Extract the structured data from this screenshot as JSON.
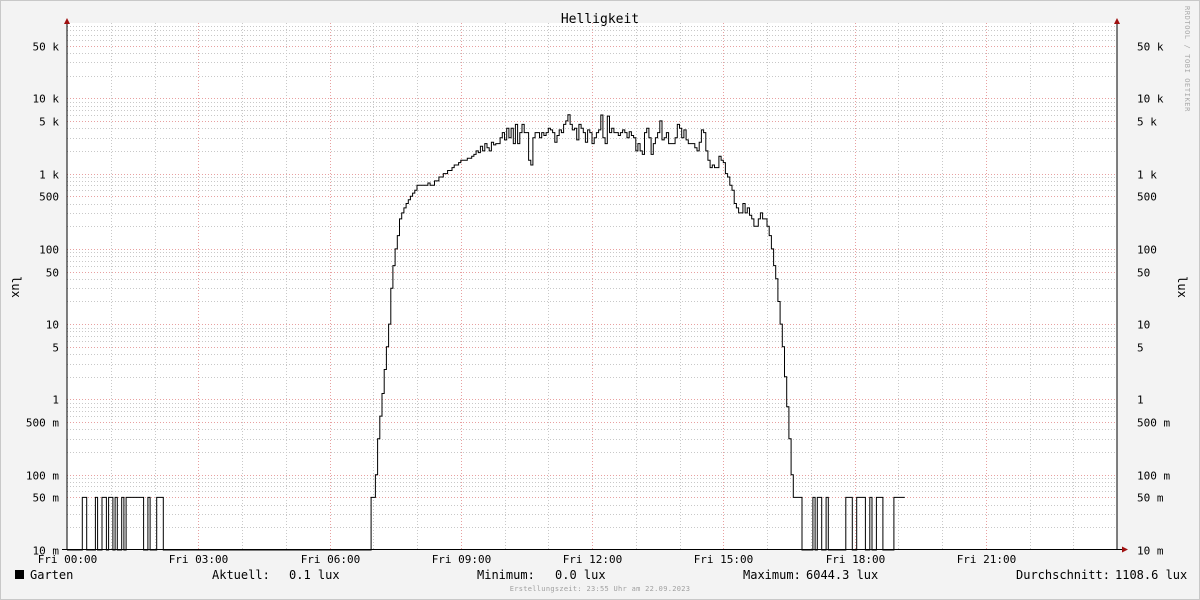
{
  "chart_data": {
    "type": "line",
    "title": "Helligkeit",
    "ylabel": "lux",
    "yscale": "log",
    "ylim": [
      0.01,
      100000
    ],
    "y_ticks": [
      {
        "value": 0.01,
        "label": "10 m"
      },
      {
        "value": 0.05,
        "label": "50 m"
      },
      {
        "value": 0.1,
        "label": "100 m"
      },
      {
        "value": 0.5,
        "label": "500 m"
      },
      {
        "value": 1,
        "label": "1"
      },
      {
        "value": 5,
        "label": "5"
      },
      {
        "value": 10,
        "label": "10"
      },
      {
        "value": 50,
        "label": "50"
      },
      {
        "value": 100,
        "label": "100"
      },
      {
        "value": 500,
        "label": "500"
      },
      {
        "value": 1000,
        "label": "1 k"
      },
      {
        "value": 5000,
        "label": "5 k"
      },
      {
        "value": 10000,
        "label": "10 k"
      },
      {
        "value": 50000,
        "label": "50 k"
      }
    ],
    "xlim_hours": [
      0,
      24
    ],
    "x_ticks": [
      {
        "hour": 0,
        "label": "Fri 00:00"
      },
      {
        "hour": 3,
        "label": "Fri 03:00"
      },
      {
        "hour": 6,
        "label": "Fri 06:00"
      },
      {
        "hour": 9,
        "label": "Fri 09:00"
      },
      {
        "hour": 12,
        "label": "Fri 12:00"
      },
      {
        "hour": 15,
        "label": "Fri 15:00"
      },
      {
        "hour": 18,
        "label": "Fri 18:00"
      },
      {
        "hour": 21,
        "label": "Fri 21:00"
      }
    ],
    "grid": true,
    "colors": {
      "line": "#000000",
      "major_grid": "#e8a0a0",
      "minor_grid": "#c8c8c8",
      "axis_arrow": "#a01010"
    },
    "series": [
      {
        "name": "Garten",
        "x_hours": [
          0,
          0.05,
          0.1,
          0.15,
          0.2,
          0.25,
          0.3,
          0.35,
          0.4,
          0.45,
          0.5,
          0.55,
          0.6,
          0.65,
          0.7,
          0.75,
          0.8,
          0.85,
          0.9,
          0.95,
          1,
          1.05,
          1.1,
          1.15,
          1.2,
          1.25,
          1.3,
          1.35,
          1.4,
          1.45,
          1.5,
          1.55,
          1.6,
          1.65,
          1.7,
          1.75,
          1.8,
          1.85,
          1.9,
          1.95,
          2,
          2.05,
          2.1,
          2.15,
          2.2,
          2.25,
          2.3,
          2.35,
          2.4,
          2.45,
          2.5,
          2.55,
          2.6,
          2.65,
          2.7,
          2.75,
          2.8,
          2.85,
          2.9,
          2.95,
          3,
          3.05,
          3.1,
          3.15,
          3.2,
          3.25,
          3.3,
          3.35,
          3.4,
          3.45,
          3.5,
          3.55,
          3.6,
          3.65,
          3.7,
          3.75,
          3.8,
          3.85,
          3.9,
          3.95,
          4,
          4.05,
          4.1,
          4.15,
          4.2,
          4.25,
          4.3,
          4.35,
          4.4,
          4.45,
          4.5,
          4.55,
          4.6,
          4.65,
          4.7,
          4.75,
          4.8,
          4.85,
          4.9,
          4.95,
          5,
          5.05,
          5.1,
          5.15,
          5.2,
          5.25,
          5.3,
          5.35,
          5.4,
          5.45,
          5.5,
          5.55,
          5.6,
          5.65,
          5.7,
          5.75,
          5.8,
          5.85,
          5.9,
          5.95,
          6,
          6.05,
          6.1,
          6.15,
          6.2,
          6.25,
          6.3,
          6.35,
          6.4,
          6.45,
          6.5,
          6.55,
          6.6,
          6.65,
          6.7,
          6.75,
          6.8,
          6.85,
          6.9,
          6.95,
          7,
          7.05,
          7.1,
          7.15,
          7.2,
          7.25,
          7.3,
          7.35,
          7.4,
          7.45,
          7.5,
          7.55,
          7.6,
          7.65,
          7.7,
          7.75,
          7.8,
          7.85,
          7.9,
          7.95,
          8,
          8.05,
          8.1,
          8.15,
          8.2,
          8.25,
          8.3,
          8.35,
          8.4,
          8.45,
          8.5,
          8.55,
          8.6,
          8.65,
          8.7,
          8.75,
          8.8,
          8.85,
          8.9,
          8.95,
          9,
          9.05,
          9.1,
          9.15,
          9.2,
          9.25,
          9.3,
          9.35,
          9.4,
          9.45,
          9.5,
          9.55,
          9.6,
          9.65,
          9.7,
          9.75,
          9.8,
          9.85,
          9.9,
          9.95,
          10,
          10.05,
          10.1,
          10.15,
          10.2,
          10.25,
          10.3,
          10.35,
          10.4,
          10.45,
          10.5,
          10.55,
          10.6,
          10.65,
          10.7,
          10.75,
          10.8,
          10.85,
          10.9,
          10.95,
          11,
          11.05,
          11.1,
          11.15,
          11.2,
          11.25,
          11.3,
          11.35,
          11.4,
          11.45,
          11.5,
          11.55,
          11.6,
          11.65,
          11.7,
          11.75,
          11.8,
          11.85,
          11.9,
          11.95,
          12,
          12.05,
          12.1,
          12.15,
          12.2,
          12.25,
          12.3,
          12.35,
          12.4,
          12.45,
          12.5,
          12.55,
          12.6,
          12.65,
          12.7,
          12.75,
          12.8,
          12.85,
          12.9,
          12.95,
          13,
          13.05,
          13.1,
          13.15,
          13.2,
          13.25,
          13.3,
          13.35,
          13.4,
          13.45,
          13.5,
          13.55,
          13.6,
          13.65,
          13.7,
          13.75,
          13.8,
          13.85,
          13.9,
          13.95,
          14,
          14.05,
          14.1,
          14.15,
          14.2,
          14.25,
          14.3,
          14.35,
          14.4,
          14.45,
          14.5,
          14.55,
          14.6,
          14.65,
          14.7,
          14.75,
          14.8,
          14.85,
          14.9,
          14.95,
          15,
          15.05,
          15.1,
          15.15,
          15.2,
          15.25,
          15.3,
          15.35,
          15.4,
          15.45,
          15.5,
          15.55,
          15.6,
          15.65,
          15.7,
          15.75,
          15.8,
          15.85,
          15.9,
          15.95,
          16,
          16.05,
          16.1,
          16.15,
          16.2,
          16.25,
          16.3,
          16.35,
          16.4,
          16.45,
          16.5,
          16.55,
          16.6,
          16.65,
          16.7,
          16.75,
          16.8,
          16.85,
          16.9,
          16.95,
          17,
          17.05,
          17.1,
          17.15,
          17.2,
          17.25,
          17.3,
          17.35,
          17.4,
          17.45,
          17.5,
          17.55,
          17.6,
          17.65,
          17.7,
          17.75,
          17.8,
          17.85,
          17.9,
          17.95,
          18,
          18.05,
          18.1,
          18.15,
          18.2,
          18.25,
          18.3,
          18.35,
          18.4,
          18.45,
          18.5,
          18.55,
          18.6,
          18.65,
          18.7,
          18.75,
          18.8,
          18.85,
          18.9,
          18.95,
          19,
          19.05,
          19.1,
          19.15,
          19.2,
          19.25,
          19.3,
          19.35,
          19.4,
          19.45,
          19.5,
          19.55,
          19.6,
          19.65,
          19.7,
          19.75,
          19.8,
          19.85,
          19.9,
          19.95,
          20,
          20.05,
          20.1,
          20.15,
          20.2,
          20.25,
          20.3,
          20.35,
          20.4,
          20.45,
          20.5,
          20.55,
          20.6,
          20.65,
          20.7,
          20.75,
          20.8,
          20.85,
          20.9,
          20.95,
          21,
          21.05,
          21.1,
          21.15,
          21.2,
          21.25,
          21.3,
          21.35,
          21.4,
          21.45,
          21.5,
          21.55,
          21.6,
          21.65,
          21.7,
          21.75,
          21.8,
          21.85,
          21.9,
          21.95,
          22,
          22.05,
          22.1,
          22.15,
          22.2,
          22.25,
          22.3,
          22.35,
          22.4,
          22.45,
          22.5,
          22.55,
          22.6,
          22.65,
          22.7,
          22.75,
          22.8,
          22.85,
          22.9,
          22.95,
          23,
          23.05,
          23.1,
          23.15,
          23.2,
          23.25,
          23.3,
          23.35,
          23.4,
          23.45,
          23.5,
          23.55,
          23.6,
          23.65,
          23.7,
          23.75,
          23.8,
          23.85,
          23.9,
          23.95
        ],
        "values": [
          0,
          0,
          0,
          0,
          0,
          0,
          0,
          0.05,
          0.05,
          0,
          0,
          0,
          0,
          0.05,
          0,
          0,
          0.05,
          0.05,
          0,
          0.05,
          0.05,
          0,
          0.05,
          0,
          0,
          0.05,
          0,
          0.05,
          0.05,
          0.05,
          0.05,
          0.05,
          0.05,
          0.05,
          0.05,
          0,
          0,
          0.05,
          0,
          0,
          0,
          0.05,
          0.05,
          0.05,
          0,
          0,
          0,
          0,
          0,
          0,
          0,
          0,
          0,
          0,
          0,
          0,
          0,
          0,
          0,
          0,
          0,
          0,
          0,
          0,
          0,
          0,
          0,
          0,
          0,
          0,
          0,
          0,
          0,
          0,
          0,
          0,
          0,
          0,
          0,
          0,
          0,
          0,
          0,
          0,
          0,
          0,
          0,
          0,
          0,
          0,
          0,
          0,
          0,
          0,
          0,
          0,
          0,
          0,
          0,
          0,
          0,
          0,
          0,
          0,
          0,
          0,
          0,
          0,
          0,
          0,
          0,
          0,
          0,
          0,
          0,
          0,
          0,
          0,
          0,
          0,
          0,
          0,
          0,
          0,
          0,
          0,
          0,
          0,
          0,
          0,
          0,
          0,
          0,
          0,
          0,
          0,
          0,
          0,
          0,
          0.05,
          0.05,
          0.1,
          0.3,
          0.6,
          1.2,
          2.5,
          5,
          10,
          30,
          60,
          100,
          150,
          250,
          300,
          350,
          400,
          450,
          500,
          550,
          600,
          700,
          700,
          700,
          700,
          700,
          750,
          700,
          700,
          800,
          800,
          900,
          900,
          1000,
          1000,
          1100,
          1100,
          1200,
          1300,
          1300,
          1400,
          1500,
          1500,
          1500,
          1600,
          1600,
          1700,
          1800,
          2000,
          1900,
          2300,
          2000,
          2500,
          2200,
          2000,
          2600,
          2400,
          2500,
          2500,
          3000,
          3500,
          2800,
          4000,
          3000,
          4000,
          2500,
          4500,
          2500,
          3500,
          4500,
          3500,
          3500,
          1500,
          1300,
          3000,
          3500,
          3500,
          3000,
          3500,
          3200,
          3500,
          4000,
          3800,
          3500,
          2600,
          3200,
          3800,
          3500,
          4500,
          5000,
          6044,
          4500,
          3800,
          4000,
          2800,
          4500,
          4000,
          3500,
          2600,
          3800,
          3500,
          2500,
          3000,
          3500,
          3800,
          6000,
          3000,
          2500,
          5800,
          3500,
          4000,
          3500,
          3500,
          3200,
          3500,
          3800,
          3500,
          3000,
          3600,
          3200,
          3000,
          2000,
          2500,
          2000,
          1800,
          3500,
          4000,
          3000,
          1800,
          2500,
          3000,
          3500,
          5000,
          2800,
          3000,
          3500,
          2500,
          2500,
          2500,
          3000,
          4500,
          4000,
          3000,
          3800,
          2800,
          2500,
          2500,
          2500,
          2200,
          2000,
          2600,
          3800,
          3500,
          2000,
          1500,
          1200,
          1300,
          1200,
          1200,
          1700,
          1500,
          1400,
          1000,
          900,
          700,
          600,
          400,
          350,
          300,
          300,
          400,
          300,
          350,
          280,
          250,
          200,
          200,
          250,
          300,
          250,
          250,
          200,
          150,
          100,
          60,
          40,
          20,
          10,
          5,
          2,
          0.8,
          0.3,
          0.1,
          0.05,
          0.05,
          0.05,
          0.05,
          0,
          0,
          0,
          0,
          0,
          0.05,
          0,
          0.05,
          0.05,
          0,
          0,
          0.05,
          0,
          0,
          0,
          0,
          0,
          0,
          0,
          0,
          0.05,
          0.05,
          0.05,
          0,
          0,
          0.05,
          0.05,
          0.05,
          0.05,
          0,
          0,
          0.05,
          0,
          0,
          0.05,
          0.05,
          0.05,
          0,
          0,
          0,
          0,
          0,
          0.05,
          0.05,
          0.05,
          0.05,
          0.05
        ]
      }
    ],
    "legend": {
      "series_name": "Garten",
      "current_label": "Aktuell:",
      "current_value": "0.1 lux",
      "min_label": "Minimum:",
      "min_value": "0.0 lux",
      "max_label": "Maximum:",
      "max_value": "6044.3 lux",
      "avg_label": "Durchschnitt:",
      "avg_value": "1108.6 lux"
    },
    "footer": "Erstellungszeit: 23:55 Uhr am 22.09.2023",
    "watermark": "RRDTOOL / TOBI OETIKER"
  }
}
